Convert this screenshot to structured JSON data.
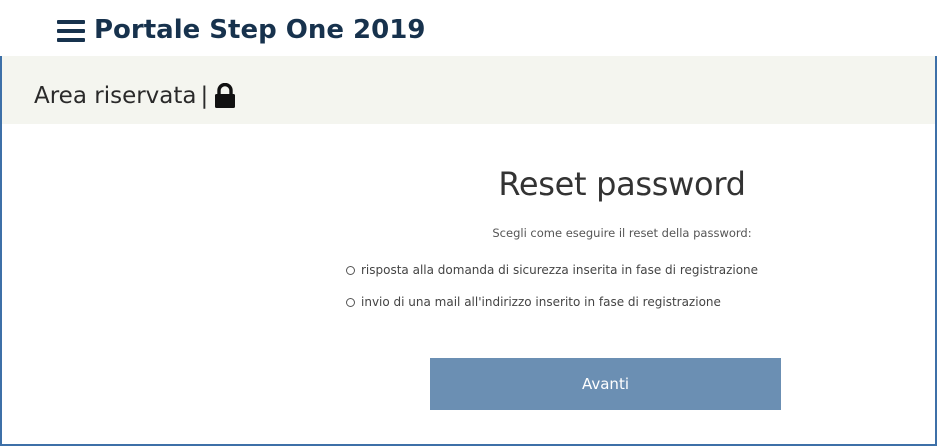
{
  "header": {
    "menu_icon": "hamburger-menu-icon",
    "title": "Portale Step One 2019"
  },
  "area": {
    "title": "Area riservata",
    "separator": "|",
    "icon": "lock-icon"
  },
  "reset": {
    "title": "Reset password",
    "subtitle": "Scegli come eseguire il reset della password:",
    "options": [
      {
        "label": "risposta alla domanda di sicurezza inserita in fase di registrazione",
        "selected": false
      },
      {
        "label": "invio di una mail all'indirizzo inserito in fase di registrazione",
        "selected": false
      }
    ],
    "submit_label": "Avanti"
  },
  "colors": {
    "brand_text": "#17324d",
    "area_background": "#f4f5ef",
    "button_background": "#6b8fb3",
    "frame_border": "#3d70a8"
  }
}
